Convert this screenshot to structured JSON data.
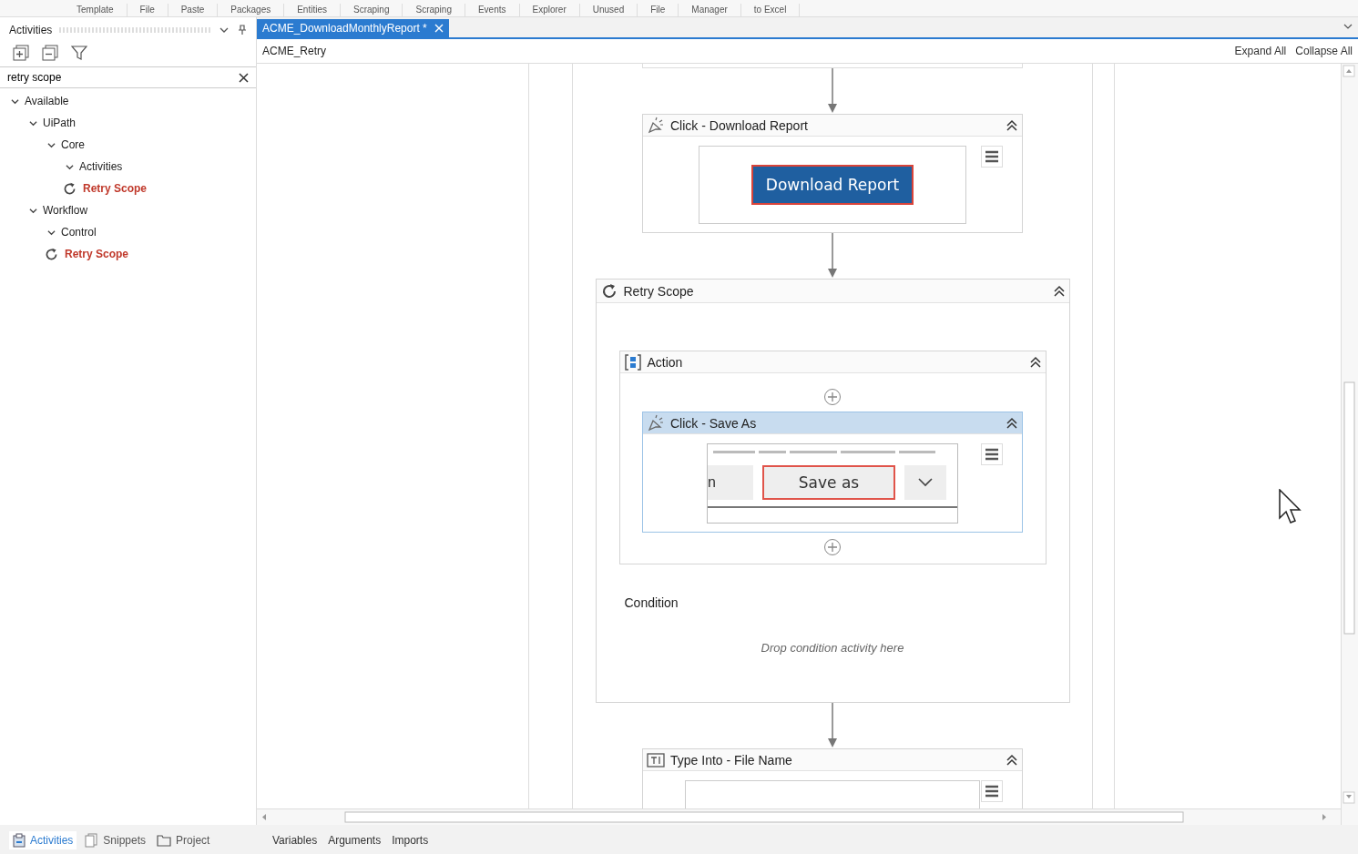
{
  "toolbar": [
    "Template",
    "File",
    "Paste",
    "Packages",
    "Entities",
    "Scraping",
    "Scraping",
    "Events",
    "Explorer",
    "Unused",
    "File",
    "Manager",
    "to Excel"
  ],
  "activities_panel": {
    "title": "Activities",
    "search": {
      "value": "retry scope"
    },
    "tree": [
      {
        "kind": "folder",
        "label": "Available",
        "expanded": true,
        "children": [
          {
            "kind": "folder",
            "label": "UiPath",
            "expanded": true,
            "children": [
              {
                "kind": "folder",
                "label": "Core",
                "expanded": true,
                "children": [
                  {
                    "kind": "folder",
                    "label": "Activities",
                    "expanded": true,
                    "children": [
                      {
                        "kind": "activity",
                        "label": "Retry Scope"
                      }
                    ]
                  }
                ]
              }
            ]
          },
          {
            "kind": "folder",
            "label": "Workflow",
            "expanded": true,
            "children": [
              {
                "kind": "folder",
                "label": "Control",
                "expanded": true,
                "children": [
                  {
                    "kind": "activity",
                    "label": "Retry Scope"
                  }
                ]
              }
            ]
          }
        ]
      }
    ]
  },
  "panel_tabs": [
    {
      "label": "Activities",
      "selected": true
    },
    {
      "label": "Snippets",
      "selected": false
    },
    {
      "label": "Project",
      "selected": false
    }
  ],
  "document_tab": {
    "title": "ACME_DownloadMonthlyReport *",
    "selected": true
  },
  "breadcrumb": "ACME_Retry",
  "view_actions": [
    "Expand All",
    "Collapse All"
  ],
  "workflow": [
    {
      "kind": "click",
      "title": "Click - Download Report",
      "selected": false,
      "target": {
        "kind": "primary",
        "label": "Download Report"
      }
    },
    {
      "kind": "retry",
      "title": "Retry Scope",
      "selected": false,
      "action": {
        "title": "Action",
        "children": [
          {
            "kind": "click",
            "title": "Click - Save As",
            "selected": true,
            "target": {
              "kind": "split",
              "label": "Save as",
              "left": "n"
            }
          }
        ]
      },
      "condition_label": "Condition",
      "condition_placeholder": "Drop condition activity here"
    },
    {
      "kind": "type",
      "title": "Type Into - File Name",
      "selected": false
    }
  ],
  "bottom_tabs": [
    "Variables",
    "Arguments",
    "Imports"
  ]
}
